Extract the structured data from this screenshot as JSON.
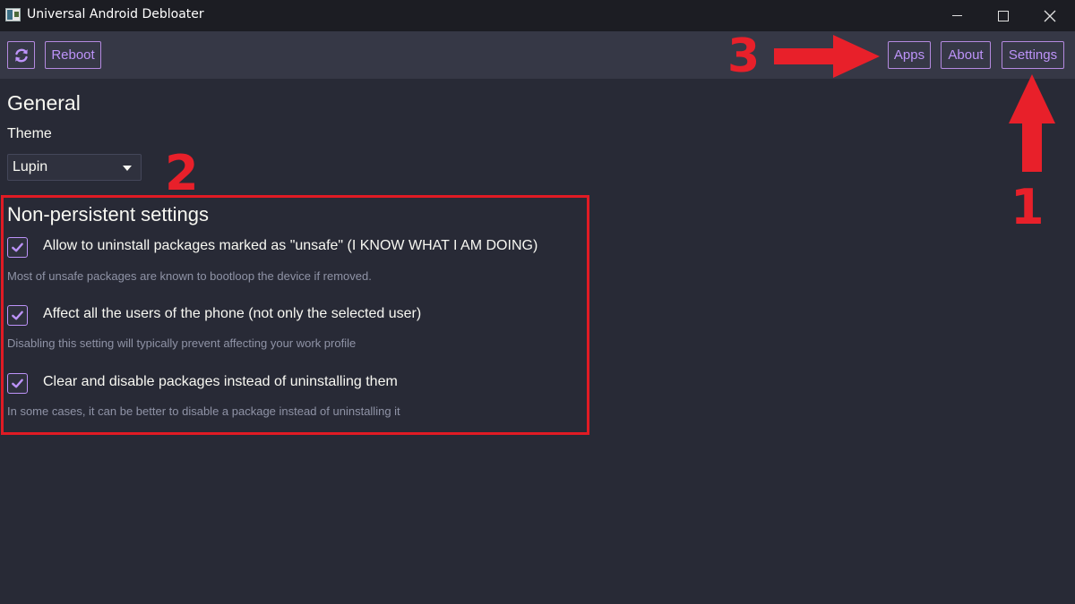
{
  "window": {
    "title": "Universal Android Debloater",
    "icon": "app-icon"
  },
  "toolbar": {
    "refresh_icon": "refresh-icon",
    "reboot_label": "Reboot",
    "apps_label": "Apps",
    "about_label": "About",
    "settings_label": "Settings"
  },
  "general": {
    "heading": "General",
    "theme_label": "Theme",
    "theme_value": "Lupin"
  },
  "non_persistent": {
    "heading": "Non-persistent settings",
    "options": [
      {
        "label": "Allow to uninstall packages marked as \"unsafe\" (I KNOW WHAT I AM DOING)",
        "description": "Most of unsafe packages are known to bootloop the device if removed.",
        "checked": true
      },
      {
        "label": "Affect all the users of the phone (not only the selected user)",
        "description": "Disabling this setting will typically prevent affecting your work profile",
        "checked": true
      },
      {
        "label": "Clear and disable packages instead of uninstalling them",
        "description": "In some cases, it can be better to disable a package instead of uninstalling it",
        "checked": true
      }
    ]
  },
  "annotations": {
    "step1": "1",
    "step2": "2",
    "step3": "3",
    "color": "#e8202a"
  },
  "colors": {
    "background": "#282a36",
    "toolbar": "#363846",
    "accent": "#bd93f9"
  }
}
